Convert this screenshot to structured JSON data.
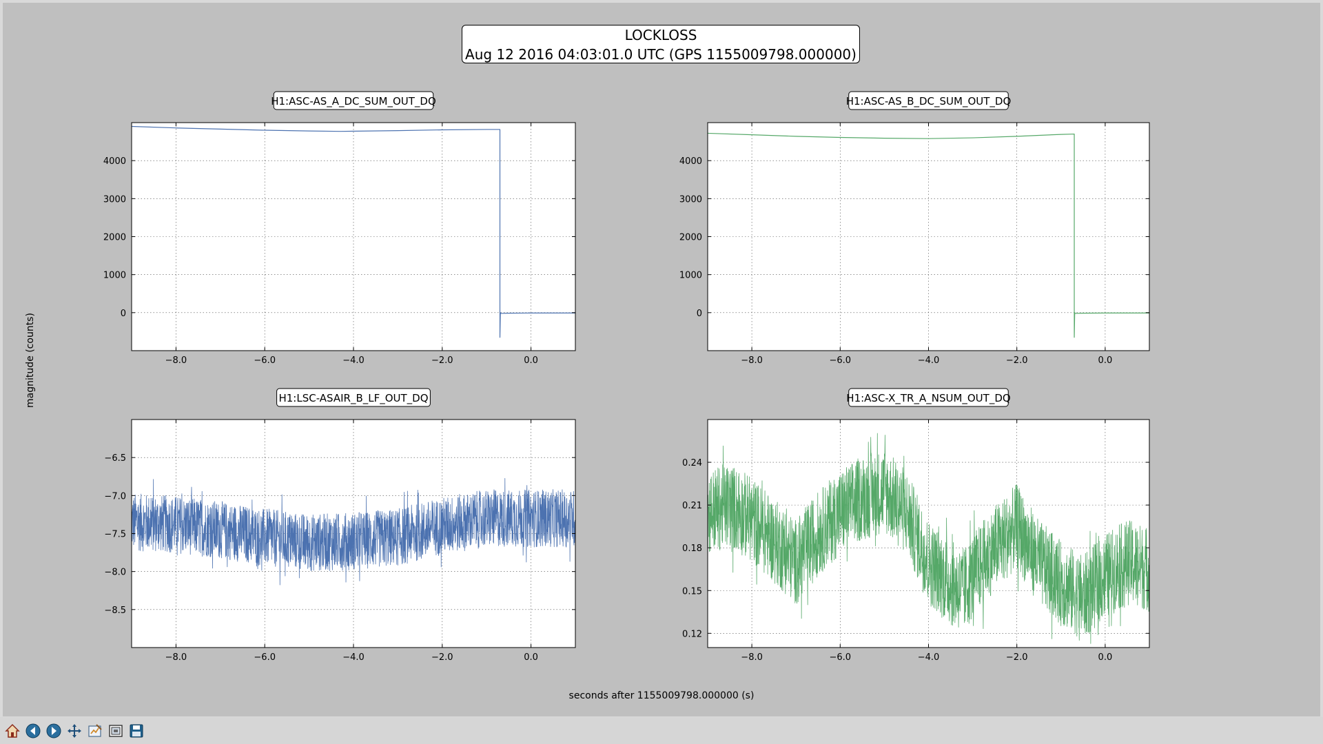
{
  "figure": {
    "title_line1": "LOCKLOSS",
    "title_line2": "Aug 12 2016 04:03:01.0 UTC (GPS 1155009798.000000)",
    "xlabel": "seconds after 1155009798.000000 (s)",
    "ylabel": "magnitude (counts)"
  },
  "toolbar": {
    "buttons": [
      {
        "name": "home-icon"
      },
      {
        "name": "back-icon"
      },
      {
        "name": "forward-icon"
      },
      {
        "name": "pan-icon"
      },
      {
        "name": "configure-subplots-icon"
      },
      {
        "name": "zoom-rect-icon"
      },
      {
        "name": "save-icon"
      }
    ]
  },
  "colors": {
    "blue": "#4c72b0",
    "green": "#55a868",
    "canvas": "#bfbfbf"
  },
  "chart_data": [
    {
      "type": "line",
      "title": "H1:ASC-AS_A_DC_SUM_OUT_DQ",
      "color": "#4c72b0",
      "xlim": [
        -9,
        1
      ],
      "ylim": [
        -1000,
        5000
      ],
      "xticks": [
        -8,
        -6,
        -4,
        -2,
        0
      ],
      "xtick_labels": [
        "−8.0",
        "−6.0",
        "−4.0",
        "−2.0",
        "0.0"
      ],
      "yticks": [
        0,
        1000,
        2000,
        3000,
        4000
      ],
      "ytick_labels": [
        "0",
        "1000",
        "2000",
        "3000",
        "4000"
      ],
      "grid": true,
      "x": [
        -9,
        -8,
        -7,
        -6,
        -5,
        -4.3,
        -3,
        -2,
        -1,
        -0.7,
        -0.7,
        -0.69,
        -0.68,
        -0.5,
        0,
        1
      ],
      "y": [
        4900,
        4860,
        4830,
        4800,
        4780,
        4770,
        4790,
        4810,
        4820,
        4820,
        -650,
        0,
        -20,
        -15,
        -10,
        -10
      ],
      "noise": 0
    },
    {
      "type": "line",
      "title": "H1:ASC-AS_B_DC_SUM_OUT_DQ",
      "color": "#55a868",
      "xlim": [
        -9,
        1
      ],
      "ylim": [
        -1000,
        5000
      ],
      "xticks": [
        -8,
        -6,
        -4,
        -2,
        0
      ],
      "xtick_labels": [
        "−8.0",
        "−6.0",
        "−4.0",
        "−2.0",
        "0.0"
      ],
      "yticks": [
        0,
        1000,
        2000,
        3000,
        4000
      ],
      "ytick_labels": [
        "0",
        "1000",
        "2000",
        "3000",
        "4000"
      ],
      "grid": true,
      "x": [
        -9,
        -8,
        -7,
        -6,
        -5,
        -4,
        -3,
        -2,
        -1,
        -0.7,
        -0.7,
        -0.69,
        -0.68,
        -0.5,
        0,
        1
      ],
      "y": [
        4720,
        4680,
        4640,
        4610,
        4590,
        4580,
        4600,
        4640,
        4690,
        4700,
        -650,
        0,
        -20,
        -15,
        -10,
        -10
      ],
      "noise": 0
    },
    {
      "type": "line",
      "title": "H1:LSC-ASAIR_B_LF_OUT_DQ",
      "color": "#4c72b0",
      "xlim": [
        -9,
        1
      ],
      "ylim": [
        -9,
        -6
      ],
      "xticks": [
        -8,
        -6,
        -4,
        -2,
        0
      ],
      "xtick_labels": [
        "−8.0",
        "−6.0",
        "−4.0",
        "−2.0",
        "0.0"
      ],
      "yticks": [
        -8.5,
        -8,
        -7.5,
        -7,
        -6.5
      ],
      "ytick_labels": [
        "−8.5",
        "−8.0",
        "−7.5",
        "−7.0",
        "−6.5"
      ],
      "grid": true,
      "x": [
        -9,
        -8,
        -7,
        -6,
        -5,
        -4,
        -3,
        -2,
        -1,
        0,
        1
      ],
      "y": [
        -7.35,
        -7.38,
        -7.45,
        -7.55,
        -7.62,
        -7.6,
        -7.55,
        -7.4,
        -7.3,
        -7.3,
        -7.3
      ],
      "noise": 0.38
    },
    {
      "type": "line",
      "title": "H1:ASC-X_TR_A_NSUM_OUT_DQ",
      "color": "#55a868",
      "xlim": [
        -9,
        1
      ],
      "ylim": [
        0.11,
        0.27
      ],
      "xticks": [
        -8,
        -6,
        -4,
        -2,
        0
      ],
      "xtick_labels": [
        "−8.0",
        "−6.0",
        "−4.0",
        "−2.0",
        "0.0"
      ],
      "yticks": [
        0.12,
        0.15,
        0.18,
        0.21,
        0.24
      ],
      "ytick_labels": [
        "0.12",
        "0.15",
        "0.18",
        "0.21",
        "0.24"
      ],
      "grid": true,
      "x": [
        -9,
        -8.5,
        -8,
        -7.5,
        -7,
        -6.5,
        -6,
        -5.5,
        -5,
        -4.5,
        -4,
        -3.5,
        -3.2,
        -3,
        -2.5,
        -2,
        -1.5,
        -1,
        -0.5,
        0,
        0.5,
        1
      ],
      "y": [
        0.205,
        0.21,
        0.2,
        0.185,
        0.17,
        0.19,
        0.205,
        0.215,
        0.22,
        0.205,
        0.17,
        0.155,
        0.15,
        0.16,
        0.18,
        0.195,
        0.17,
        0.155,
        0.145,
        0.16,
        0.17,
        0.165
      ],
      "noise": 0.03
    }
  ]
}
